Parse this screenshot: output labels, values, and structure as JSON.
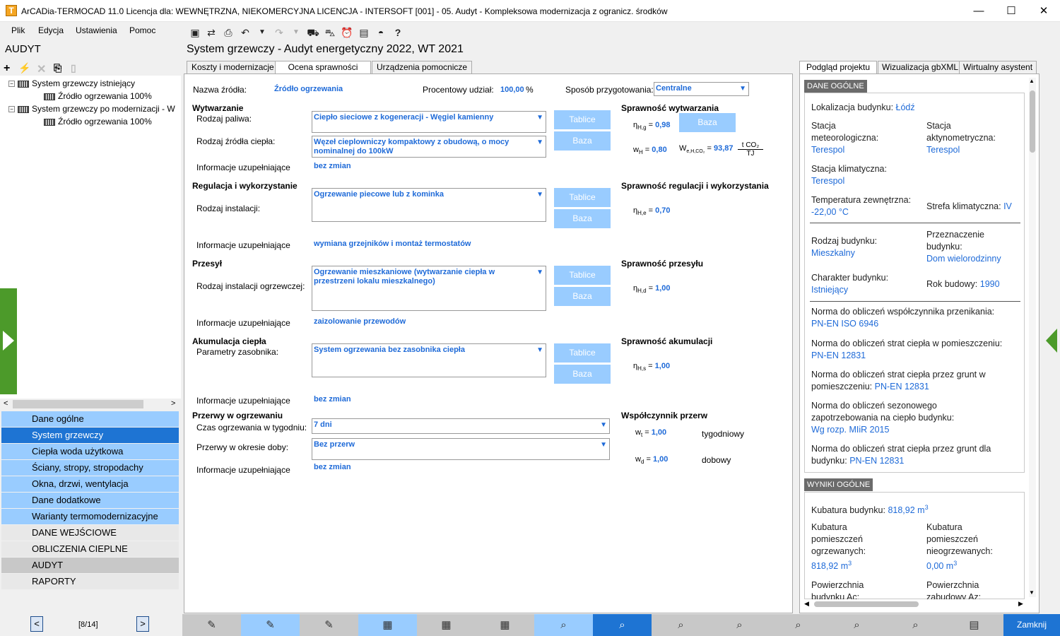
{
  "window": {
    "title": "ArCADia-TERMOCAD 11.0 Licencja dla: WEWNĘTRZNA, NIEKOMERCYJNA LICENCJA - INTERSOFT [001] - 05. Audyt - Kompleksowa modernizacja z ogranicz. środków",
    "icon_letter": "T",
    "min": "—",
    "max": "☐",
    "close": "✕"
  },
  "menu": {
    "file": "Plik",
    "edit": "Edycja",
    "settings": "Ustawienia",
    "help": "Pomoc"
  },
  "toolbar_icons": [
    "save-icon",
    "refresh-icon",
    "print-preview-icon",
    "undo-icon",
    "undo-dropdown-icon",
    "redo-icon",
    "redo-dropdown-icon",
    "import-icon",
    "car-icon",
    "alarm-icon",
    "calculator-icon",
    "gauge-icon",
    "help-icon"
  ],
  "left": {
    "header": "AUDYT",
    "tree": [
      {
        "label": "System grzewczy istniejący",
        "level": 0
      },
      {
        "label": "Źródło ogrzewania 100%",
        "level": 1
      },
      {
        "label": "System grzewczy po modernizacji - W",
        "level": 0
      },
      {
        "label": "Źródło ogrzewania 100%",
        "level": 1
      }
    ],
    "nav": [
      {
        "label": "Dane ogólne"
      },
      {
        "label": "System grzewczy"
      },
      {
        "label": "Ciepła woda użytkowa"
      },
      {
        "label": "Ściany, stropy, stropodachy"
      },
      {
        "label": "Okna, drzwi, wentylacja"
      },
      {
        "label": "Dane dodatkowe"
      },
      {
        "label": "Warianty termomodernizacyjne"
      },
      {
        "label": "DANE WEJŚCIOWE"
      },
      {
        "label": "OBLICZENIA CIEPLNE"
      },
      {
        "label": "AUDYT"
      },
      {
        "label": "RAPORTY"
      }
    ],
    "pager": "[8/14]",
    "prev": "<",
    "next": ">"
  },
  "main": {
    "title": "System grzewczy - Audyt energetyczny 2022, WT 2021",
    "tabs": [
      "Koszty i modernizacje",
      "Ocena sprawności",
      "Urządzenia pomocnicze"
    ],
    "source_name_label": "Nazwa źródła:",
    "source_name": "Źródło ogrzewania",
    "percent_label": "Procentowy udział:",
    "percent": "100,00",
    "percent_unit": "%",
    "prep_label": "Sposób przygotowania:",
    "prep": "Centralne",
    "production": {
      "title": "Wytwarzanie",
      "fuel_label": "Rodzaj paliwa:",
      "fuel": "Ciepło sieciowe z kogeneracji - Węgiel kamienny",
      "heat_source_label": "Rodzaj źródła ciepła:",
      "heat_source": "Węzeł cieplowniczy kompaktowy z obudową, o mocy nominalnej do 100kW",
      "info_label": "Informacje uzupełniające",
      "info": "bez zmian"
    },
    "regulation": {
      "title": "Regulacja i wykorzystanie",
      "install_label": "Rodzaj instalacji:",
      "install": "Ogrzewanie piecowe lub z kominka",
      "info_label": "Informacje uzupełniające",
      "info": "wymiana grzejników i montaż termostatów"
    },
    "transfer": {
      "title": "Przesył",
      "install_label": "Rodzaj instalacji ogrzewczej:",
      "install": "Ogrzewanie mieszkaniowe (wytwarzanie ciepła w przestrzeni lokalu mieszkalnego)",
      "info_label": "Informacje uzupełniające",
      "info": "zaizolowanie przewodów"
    },
    "storage": {
      "title": "Akumulacja ciepła",
      "param_label": "Parametry zasobnika:",
      "param": "System ogrzewania bez zasobnika ciepła",
      "info_label": "Informacje uzupełniające",
      "info": "bez zmian"
    },
    "breaks": {
      "title": "Przerwy w ogrzewaniu",
      "week_label": "Czas ogrzewania w tygodniu:",
      "week": "7 dni",
      "day_label": "Przerwy w okresie doby:",
      "day": "Bez przerw",
      "info_label": "Informacje uzupełniające",
      "info": "bez zmian"
    },
    "btn_tables": "Tablice",
    "btn_base": "Baza",
    "eff_production": {
      "title": "Sprawność wytwarzania",
      "eta_sym": "η",
      "eta_sub": "H,g",
      "eta": "0,98",
      "w_sym": "w",
      "w_sub": "H",
      "w": "0,80",
      "we_sym": "W",
      "we_sub": "e,H,CO₂",
      "we": "93,87",
      "unit_num": "t CO₂",
      "unit_den": "TJ"
    },
    "eff_regulation": {
      "title": "Sprawność regulacji i wykorzystania",
      "eta_sym": "η",
      "eta_sub": "H,e",
      "eta": "0,70"
    },
    "eff_transfer": {
      "title": "Sprawność przesyłu",
      "eta_sym": "η",
      "eta_sub": "H,d",
      "eta": "1,00"
    },
    "eff_storage": {
      "title": "Sprawność akumulacji",
      "eta_sym": "η",
      "eta_sub": "H,s",
      "eta": "1,00"
    },
    "eff_breaks": {
      "title": "Współczynnik przerw",
      "wt_sym": "w",
      "wt_sub": "t",
      "wt": "1,00",
      "wt_desc": "tygodniowy",
      "wd_sym": "w",
      "wd_sub": "d",
      "wd": "1,00",
      "wd_desc": "dobowy"
    }
  },
  "right": {
    "tabs": [
      "Podgląd projektu",
      "Wizualizacja gbXML",
      "Wirtualny asystent"
    ],
    "general_header": "DANE OGÓLNE",
    "location_label": "Lokalizacja budynku:",
    "location": "Łódź",
    "met_label": "Stacja meteorologiczna:",
    "met": "Terespol",
    "act_label": "Stacja aktynometryczna:",
    "act": "Terespol",
    "clim_label": "Stacja klimatyczna:",
    "clim": "Terespol",
    "temp_label": "Temperatura zewnętrzna:",
    "temp": "-22,00 °C",
    "zone_label": "Strefa klimatyczna:",
    "zone": "IV",
    "btype_label": "Rodzaj budynku:",
    "btype": "Mieszkalny",
    "purpose_label": "Przeznaczenie budynku:",
    "purpose": "Dom wielorodzinny",
    "char_label": "Charakter budynku:",
    "char": "Istniejący",
    "year_label": "Rok budowy:",
    "year": "1990",
    "norm1_label": "Norma do obliczeń współczynnika przenikania:",
    "norm1": "PN-EN ISO 6946",
    "norm2_label": "Norma do obliczeń strat ciepła w pomieszczeniu:",
    "norm2": "PN-EN 12831",
    "norm3_label": "Norma do obliczeń strat ciepła przez grunt w pomieszczeniu:",
    "norm3": "PN-EN 12831",
    "norm4_label": "Norma do obliczeń sezonowego zapotrzebowania na ciepło budynku:",
    "norm4": "Wg rozp. MIiR 2015",
    "norm5_label": "Norma do obliczeń strat ciepła przez grunt dla budynku:",
    "norm5": "PN-EN 12831",
    "results_header": "WYNIKI OGÓLNE",
    "volume_label": "Kubatura budynku:",
    "volume": "818,92 m",
    "volume_sup": "3",
    "heated_label": "Kubatura pomieszczeń ogrzewanych:",
    "heated": "818,92 m",
    "heated_sup": "3",
    "unheated_label": "Kubatura pomieszczeń nieogrzewanych:",
    "unheated": "0,00 m",
    "unheated_sup": "3",
    "area_label": "Powierzchnia budynku Ac:",
    "built_label": "Powierzchnia zabudowy Az:"
  },
  "bottom": {
    "close": "Zamknij"
  },
  "colors": {
    "accent": "#1e74d3",
    "nav_blue": "#99ccff",
    "button": "#99ccff",
    "value": "#1e6ad8",
    "green": "#4c9a2a"
  }
}
